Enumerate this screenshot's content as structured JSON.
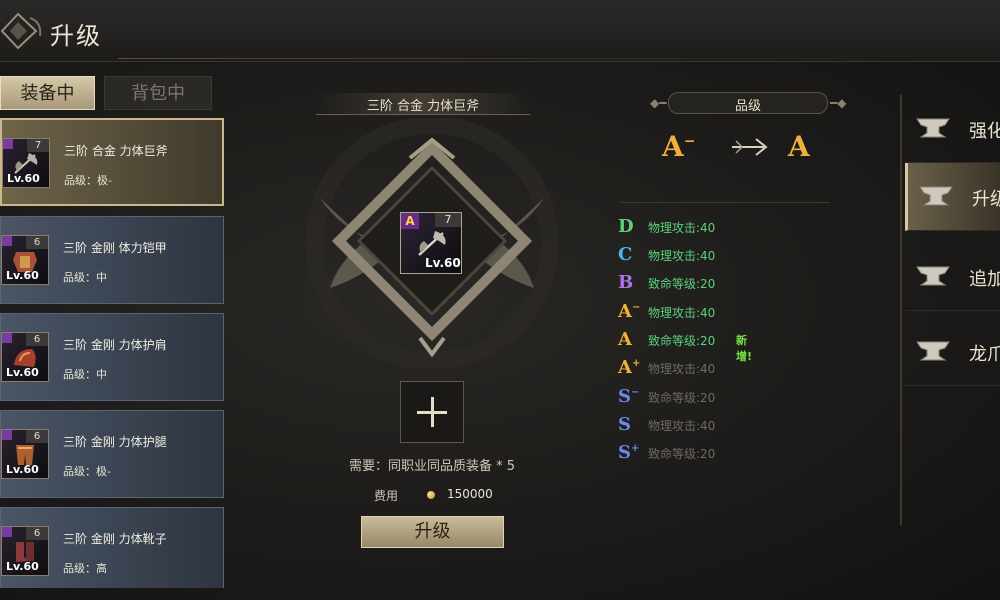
{
  "title": "升级",
  "tabs": {
    "equipped": "装备中",
    "backpack": "背包中"
  },
  "items": [
    {
      "name": "三阶 合金 力体巨斧",
      "quality": "品级：极-",
      "count": "7",
      "level": "Lv.60"
    },
    {
      "name": "三阶 金刚 体力铠甲",
      "quality": "品级：中",
      "count": "6",
      "level": "Lv.60"
    },
    {
      "name": "三阶 金刚 力体护肩",
      "quality": "品级：中",
      "count": "6",
      "level": "Lv.60"
    },
    {
      "name": "三阶 金刚 力体护腿",
      "quality": "品级：极-",
      "count": "6",
      "level": "Lv.60"
    },
    {
      "name": "三阶 金刚 力体靴子",
      "quality": "品级：高",
      "count": "6",
      "level": "Lv.60"
    }
  ],
  "center": {
    "item_title": "三阶 合金 力体巨斧",
    "slot_grade": "A",
    "slot_count": "7",
    "slot_level": "Lv.60",
    "requirement": "需要：同职业同品质装备 * 5",
    "cost_label": "费用",
    "cost_value": "150000",
    "upgrade_button": "升级"
  },
  "grade_panel": {
    "header": "品级",
    "from_grade": "A",
    "from_suffix": "−",
    "to_grade": "A",
    "rows": [
      {
        "letter": "D",
        "suffix": "",
        "text": "物理攻击:40",
        "color": "#5ad07a",
        "text_color": "#5ad07a",
        "tag": ""
      },
      {
        "letter": "C",
        "suffix": "",
        "text": "物理攻击:40",
        "color": "#48b8e8",
        "text_color": "#5ad07a",
        "tag": ""
      },
      {
        "letter": "B",
        "suffix": "",
        "text": "致命等级:20",
        "color": "#b070e8",
        "text_color": "#5ad07a",
        "tag": ""
      },
      {
        "letter": "A",
        "suffix": "−",
        "text": "物理攻击:40",
        "color": "#f0b03a",
        "text_color": "#5ad07a",
        "tag": ""
      },
      {
        "letter": "A",
        "suffix": "",
        "text": "致命等级:20",
        "color": "#f0b03a",
        "text_color": "#5ad07a",
        "tag": "新增!"
      },
      {
        "letter": "A",
        "suffix": "+",
        "text": "物理攻击:40",
        "color": "#f0b03a",
        "text_color": "#6e6a62",
        "tag": ""
      },
      {
        "letter": "S",
        "suffix": "−",
        "text": "致命等级:20",
        "color": "#6a8ae8",
        "text_color": "#6e6a62",
        "tag": ""
      },
      {
        "letter": "S",
        "suffix": "",
        "text": "物理攻击:40",
        "color": "#6a8ae8",
        "text_color": "#6e6a62",
        "tag": ""
      },
      {
        "letter": "S",
        "suffix": "+",
        "text": "致命等级:20",
        "color": "#6a8ae8",
        "text_color": "#6e6a62",
        "tag": ""
      }
    ]
  },
  "nav": [
    {
      "label": "强化",
      "active": false
    },
    {
      "label": "升级",
      "active": true
    },
    {
      "label": "追加",
      "active": false
    },
    {
      "label": "龙爪",
      "active": false
    }
  ],
  "colors": {
    "gold_grade": "#f0b03a",
    "active_tab": "#c9bc98",
    "new_tag": "#78e048"
  }
}
